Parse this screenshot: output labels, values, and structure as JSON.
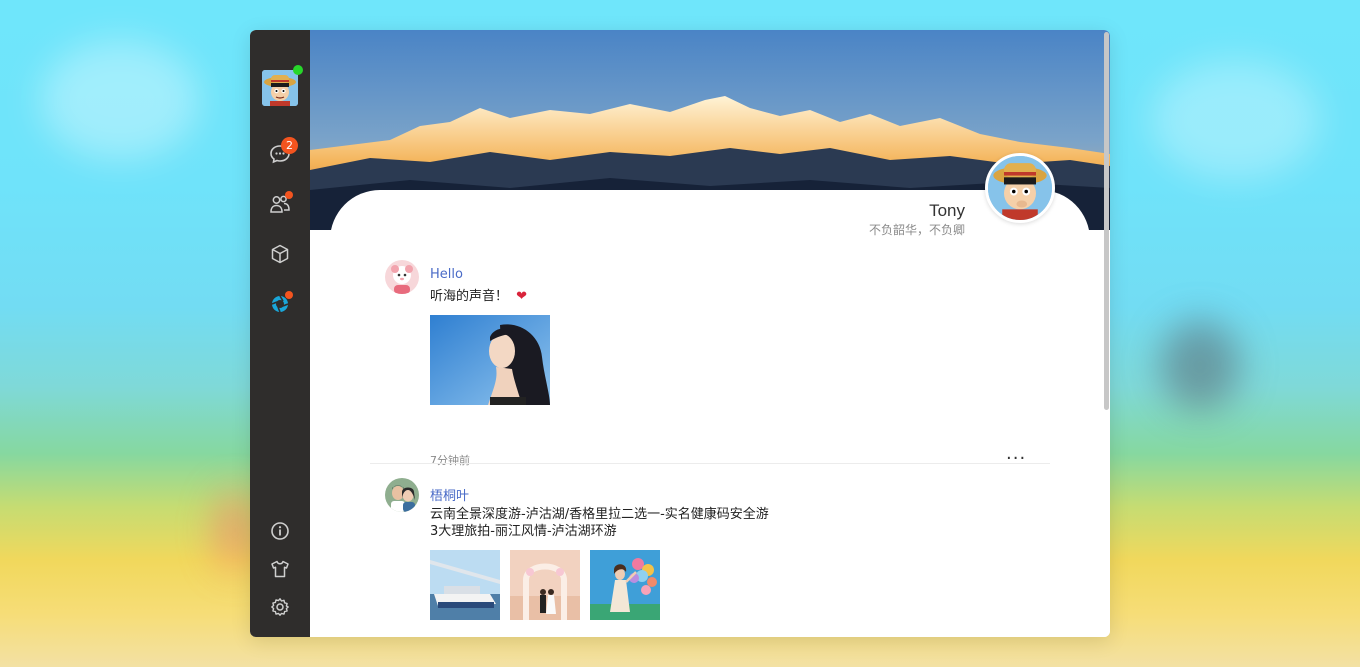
{
  "profile": {
    "name": "Tony",
    "motto": "不负韶华，不负卿"
  },
  "sidebar": {
    "unread_count": "2",
    "items": [
      {
        "icon": "chat-bubble-icon"
      },
      {
        "icon": "contacts-icon"
      },
      {
        "icon": "box-icon"
      },
      {
        "icon": "moments-icon"
      }
    ],
    "bottom": [
      {
        "icon": "info-icon"
      },
      {
        "icon": "tshirt-icon"
      },
      {
        "icon": "gear-icon"
      }
    ]
  },
  "posts": [
    {
      "author": "Hello",
      "text": "听海的声音！",
      "emoji": "❤",
      "time": "7分钟前",
      "more": "···"
    },
    {
      "author": "梧桐叶",
      "text_line1": "云南全景深度游-泸沽湖/香格里拉二选一-实名健康码安全游",
      "text_line2": "3大理旅拍-丽江风情-泸沽湖环游"
    }
  ],
  "fab_label": "+",
  "colors": {
    "accent": "#1a5ff3",
    "sidebar_bg": "#2f2d2c",
    "badge": "#f3541f",
    "online": "#27d62a",
    "author_link": "#4a6bc7"
  }
}
